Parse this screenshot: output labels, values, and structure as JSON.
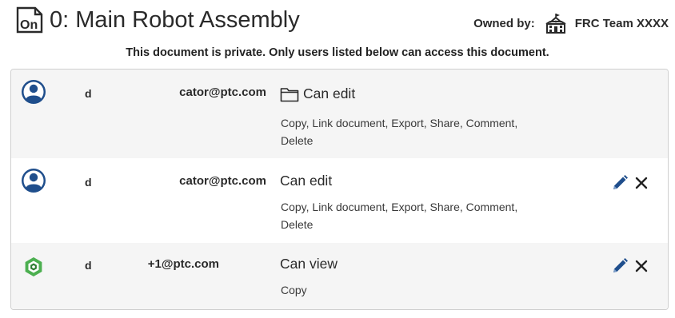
{
  "header": {
    "logo_icon": "onshape-document-icon",
    "logo_text": "On",
    "title": "0: Main Robot Assembly",
    "owned_by_label": "Owned by:",
    "owner_icon": "school-building-icon",
    "owner_name": "FRC Team XXXX"
  },
  "notice": "This document is private. Only users listed below can access this document.",
  "shares": [
    {
      "avatar": "user-avatar-icon",
      "name": "d",
      "email": "cator@ptc.com",
      "permission_icon": "folder-icon",
      "permission": "Can edit",
      "rights": "Copy, Link document, Export, Share, Comment, Delete",
      "editable": false
    },
    {
      "avatar": "user-avatar-icon",
      "name": "d",
      "email": "cator@ptc.com",
      "permission": "Can edit",
      "rights": "Copy, Link document, Export, Share, Comment, Delete",
      "editable": true
    },
    {
      "avatar": "onshape-app-icon",
      "name": "d",
      "email": "+1@ptc.com",
      "permission": "Can view",
      "rights": "Copy",
      "editable": true
    }
  ],
  "colors": {
    "accent_blue": "#1f4e8c",
    "row_alt_bg": "#f5f5f5",
    "border": "#cfcfcf",
    "onshape_green": "#4caf50"
  }
}
